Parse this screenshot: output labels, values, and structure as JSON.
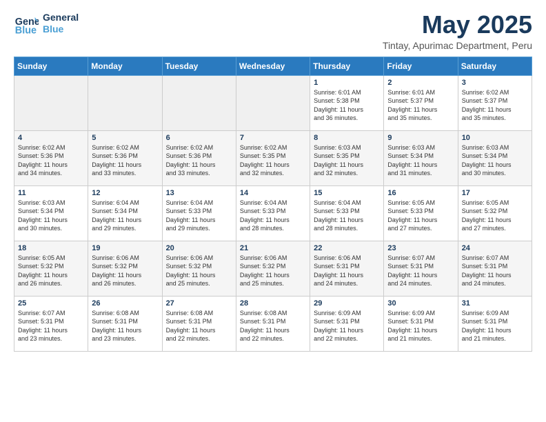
{
  "logo": {
    "line1": "General",
    "line2": "Blue"
  },
  "title": "May 2025",
  "subtitle": "Tintay, Apurimac Department, Peru",
  "headers": [
    "Sunday",
    "Monday",
    "Tuesday",
    "Wednesday",
    "Thursday",
    "Friday",
    "Saturday"
  ],
  "weeks": [
    [
      {
        "day": "",
        "info": ""
      },
      {
        "day": "",
        "info": ""
      },
      {
        "day": "",
        "info": ""
      },
      {
        "day": "",
        "info": ""
      },
      {
        "day": "1",
        "info": "Sunrise: 6:01 AM\nSunset: 5:38 PM\nDaylight: 11 hours\nand 36 minutes."
      },
      {
        "day": "2",
        "info": "Sunrise: 6:01 AM\nSunset: 5:37 PM\nDaylight: 11 hours\nand 35 minutes."
      },
      {
        "day": "3",
        "info": "Sunrise: 6:02 AM\nSunset: 5:37 PM\nDaylight: 11 hours\nand 35 minutes."
      }
    ],
    [
      {
        "day": "4",
        "info": "Sunrise: 6:02 AM\nSunset: 5:36 PM\nDaylight: 11 hours\nand 34 minutes."
      },
      {
        "day": "5",
        "info": "Sunrise: 6:02 AM\nSunset: 5:36 PM\nDaylight: 11 hours\nand 33 minutes."
      },
      {
        "day": "6",
        "info": "Sunrise: 6:02 AM\nSunset: 5:36 PM\nDaylight: 11 hours\nand 33 minutes."
      },
      {
        "day": "7",
        "info": "Sunrise: 6:02 AM\nSunset: 5:35 PM\nDaylight: 11 hours\nand 32 minutes."
      },
      {
        "day": "8",
        "info": "Sunrise: 6:03 AM\nSunset: 5:35 PM\nDaylight: 11 hours\nand 32 minutes."
      },
      {
        "day": "9",
        "info": "Sunrise: 6:03 AM\nSunset: 5:34 PM\nDaylight: 11 hours\nand 31 minutes."
      },
      {
        "day": "10",
        "info": "Sunrise: 6:03 AM\nSunset: 5:34 PM\nDaylight: 11 hours\nand 30 minutes."
      }
    ],
    [
      {
        "day": "11",
        "info": "Sunrise: 6:03 AM\nSunset: 5:34 PM\nDaylight: 11 hours\nand 30 minutes."
      },
      {
        "day": "12",
        "info": "Sunrise: 6:04 AM\nSunset: 5:34 PM\nDaylight: 11 hours\nand 29 minutes."
      },
      {
        "day": "13",
        "info": "Sunrise: 6:04 AM\nSunset: 5:33 PM\nDaylight: 11 hours\nand 29 minutes."
      },
      {
        "day": "14",
        "info": "Sunrise: 6:04 AM\nSunset: 5:33 PM\nDaylight: 11 hours\nand 28 minutes."
      },
      {
        "day": "15",
        "info": "Sunrise: 6:04 AM\nSunset: 5:33 PM\nDaylight: 11 hours\nand 28 minutes."
      },
      {
        "day": "16",
        "info": "Sunrise: 6:05 AM\nSunset: 5:33 PM\nDaylight: 11 hours\nand 27 minutes."
      },
      {
        "day": "17",
        "info": "Sunrise: 6:05 AM\nSunset: 5:32 PM\nDaylight: 11 hours\nand 27 minutes."
      }
    ],
    [
      {
        "day": "18",
        "info": "Sunrise: 6:05 AM\nSunset: 5:32 PM\nDaylight: 11 hours\nand 26 minutes."
      },
      {
        "day": "19",
        "info": "Sunrise: 6:06 AM\nSunset: 5:32 PM\nDaylight: 11 hours\nand 26 minutes."
      },
      {
        "day": "20",
        "info": "Sunrise: 6:06 AM\nSunset: 5:32 PM\nDaylight: 11 hours\nand 25 minutes."
      },
      {
        "day": "21",
        "info": "Sunrise: 6:06 AM\nSunset: 5:32 PM\nDaylight: 11 hours\nand 25 minutes."
      },
      {
        "day": "22",
        "info": "Sunrise: 6:06 AM\nSunset: 5:31 PM\nDaylight: 11 hours\nand 24 minutes."
      },
      {
        "day": "23",
        "info": "Sunrise: 6:07 AM\nSunset: 5:31 PM\nDaylight: 11 hours\nand 24 minutes."
      },
      {
        "day": "24",
        "info": "Sunrise: 6:07 AM\nSunset: 5:31 PM\nDaylight: 11 hours\nand 24 minutes."
      }
    ],
    [
      {
        "day": "25",
        "info": "Sunrise: 6:07 AM\nSunset: 5:31 PM\nDaylight: 11 hours\nand 23 minutes."
      },
      {
        "day": "26",
        "info": "Sunrise: 6:08 AM\nSunset: 5:31 PM\nDaylight: 11 hours\nand 23 minutes."
      },
      {
        "day": "27",
        "info": "Sunrise: 6:08 AM\nSunset: 5:31 PM\nDaylight: 11 hours\nand 22 minutes."
      },
      {
        "day": "28",
        "info": "Sunrise: 6:08 AM\nSunset: 5:31 PM\nDaylight: 11 hours\nand 22 minutes."
      },
      {
        "day": "29",
        "info": "Sunrise: 6:09 AM\nSunset: 5:31 PM\nDaylight: 11 hours\nand 22 minutes."
      },
      {
        "day": "30",
        "info": "Sunrise: 6:09 AM\nSunset: 5:31 PM\nDaylight: 11 hours\nand 21 minutes."
      },
      {
        "day": "31",
        "info": "Sunrise: 6:09 AM\nSunset: 5:31 PM\nDaylight: 11 hours\nand 21 minutes."
      }
    ]
  ]
}
